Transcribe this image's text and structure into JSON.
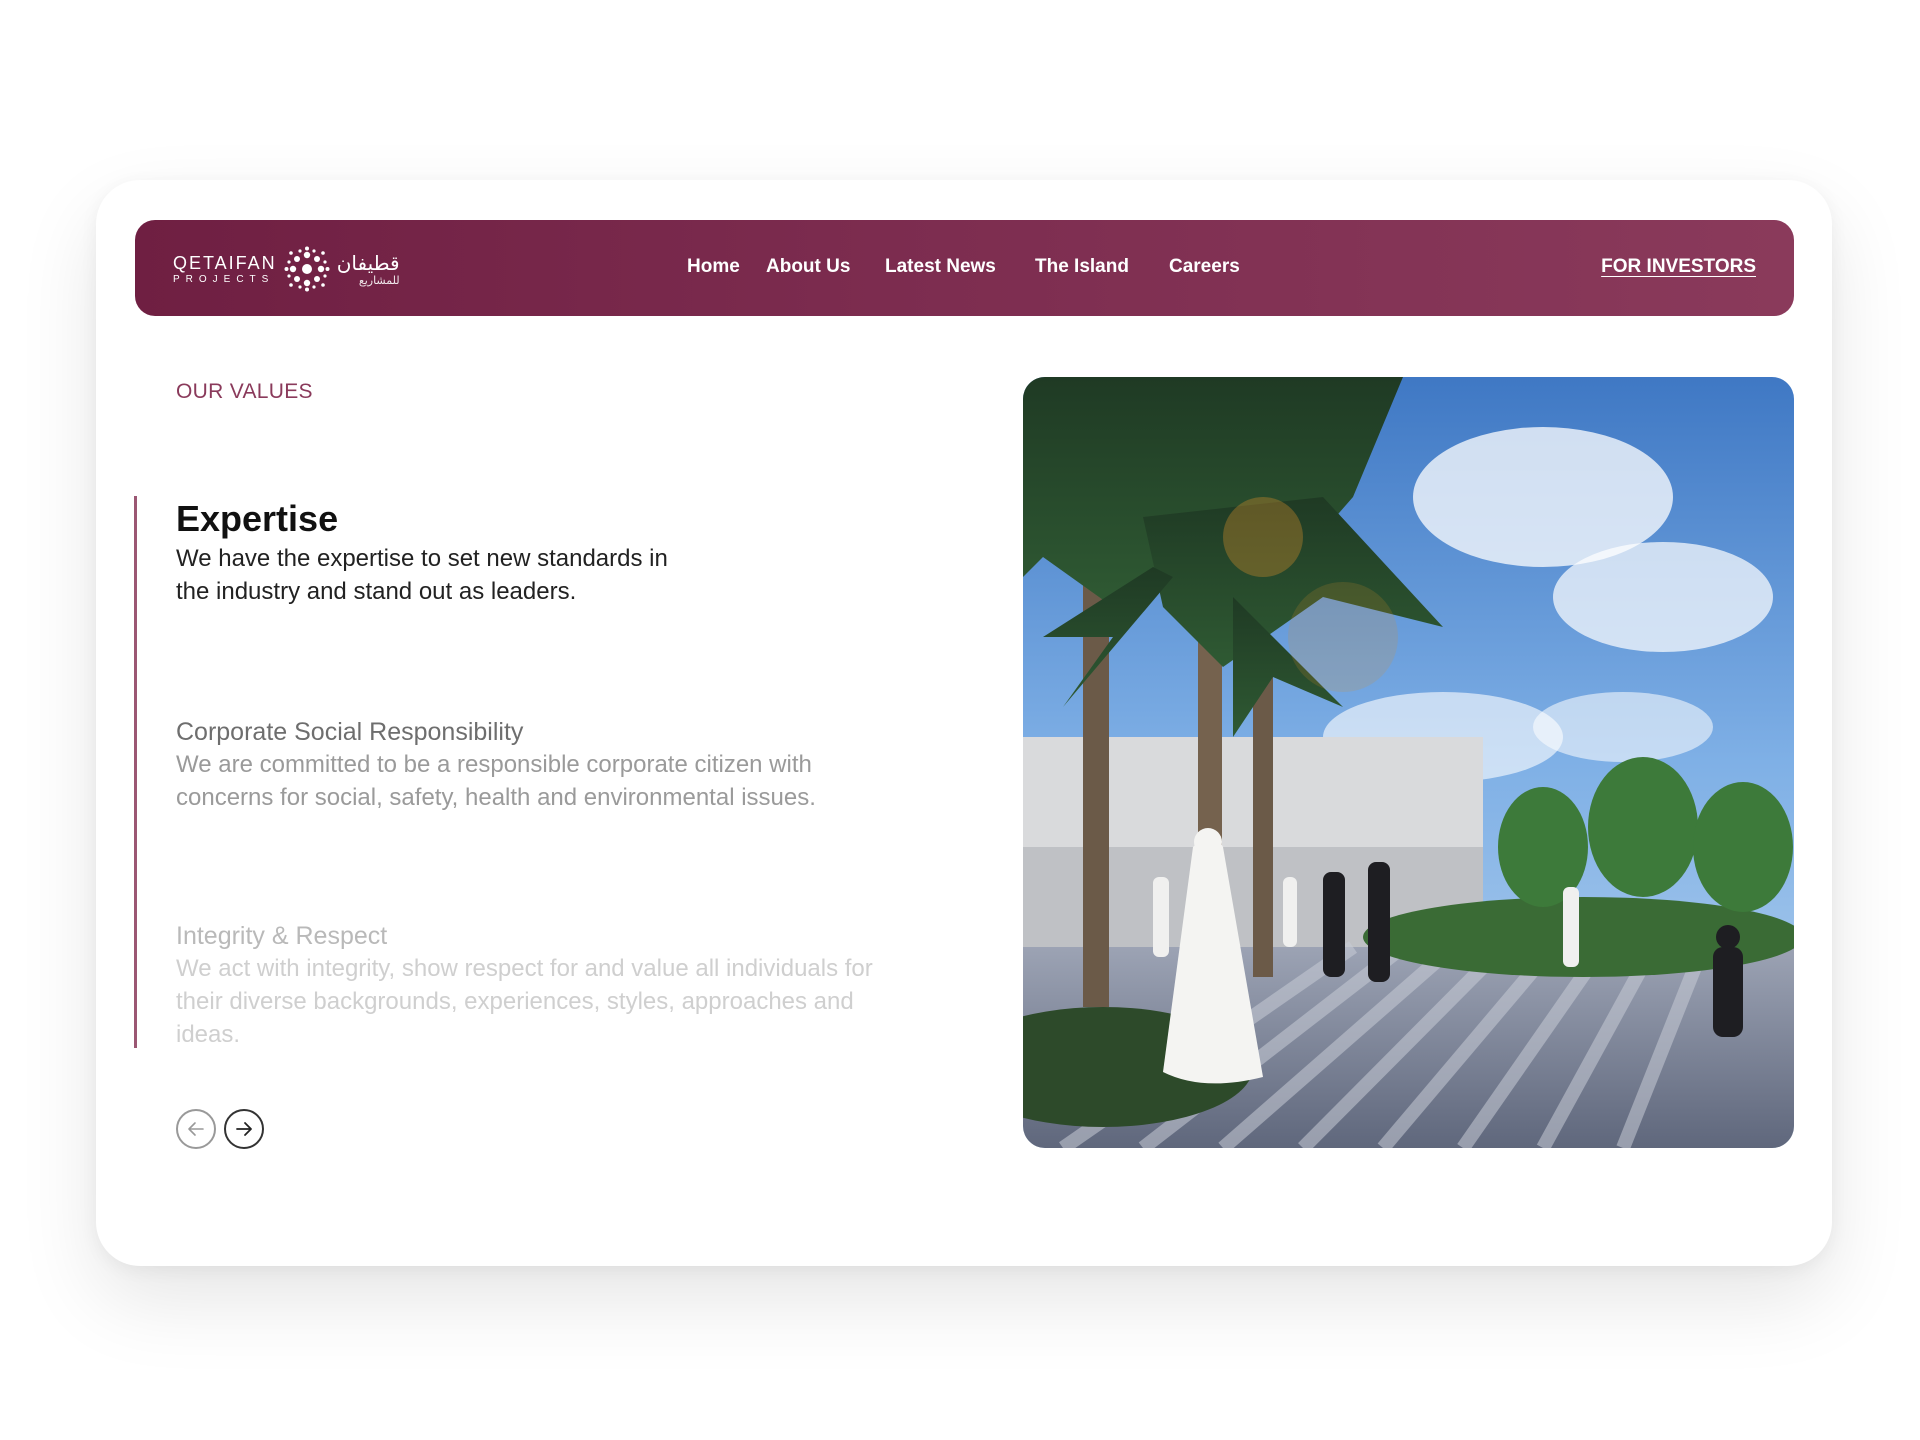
{
  "header": {
    "logo": {
      "name": "QETAIFAN",
      "sub": "PROJECTS",
      "arabic_main": "قطيفان",
      "arabic_sub": "للمشاريع"
    },
    "nav": [
      "Home",
      "About Us",
      "Latest News",
      "The Island",
      "Careers"
    ],
    "investors_label": "FOR INVESTORS"
  },
  "section": {
    "label": "OUR VALUES",
    "values": [
      {
        "title": "Expertise",
        "text": "We have the expertise to set new standards in the industry and stand out as leaders."
      },
      {
        "title": "Corporate Social Responsibility",
        "text": "We are committed to be a responsible corporate citizen with concerns for social, safety, health and environmental issues."
      },
      {
        "title": "Integrity & Respect",
        "text": "We act with integrity, show respect for and value all individuals for their diverse backgrounds, experiences, styles, approaches and ideas."
      }
    ]
  },
  "icons": {
    "prev": "arrow-left-icon",
    "next": "arrow-right-icon",
    "logo_mark": "flower-emblem-icon"
  },
  "colors": {
    "brand": "#7c2c4f",
    "accent": "#8a3a5b"
  }
}
